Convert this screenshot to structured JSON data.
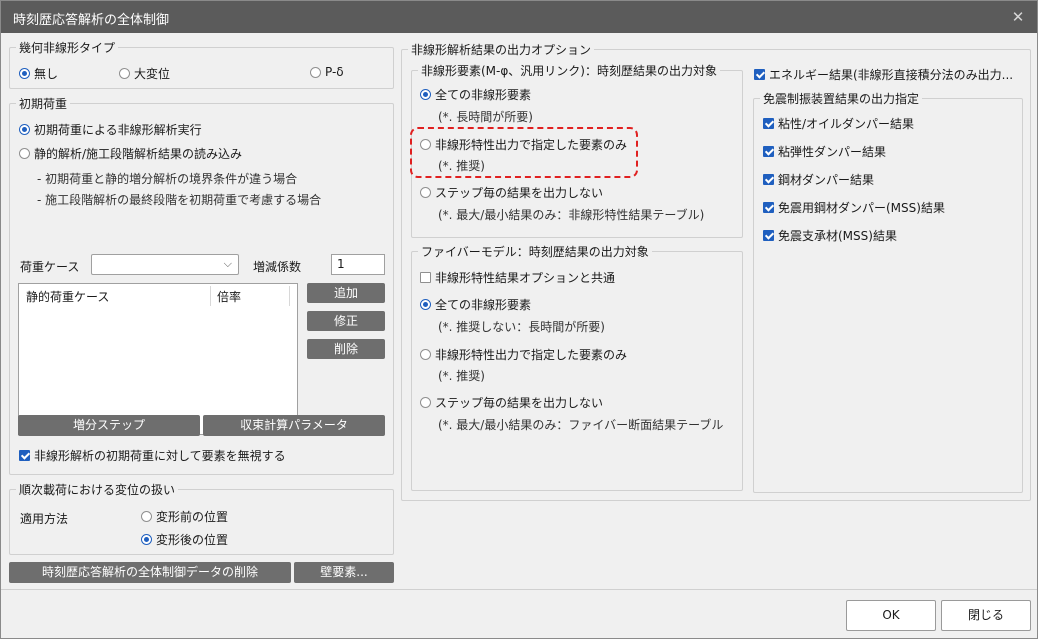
{
  "window": {
    "title": "時刻歴応答解析の全体制御"
  },
  "icons": {
    "close": "✕",
    "dropdown": "⌵"
  },
  "nonlinear_type": {
    "legend": "幾何非線形タイプ",
    "options": [
      "無し",
      "大変位",
      "P-δ"
    ],
    "selected": "無し"
  },
  "initial_load": {
    "legend": "初期荷重",
    "option_run": "初期荷重による非線形解析実行",
    "option_read": "静的解析/施工段階解析結果の読み込み",
    "note1": "- 初期荷重と静的増分解析の境界条件が違う場合",
    "note2": "- 施工段階解析の最終段階を初期荷重で考慮する場合",
    "load_case_label": "荷重ケース",
    "load_case_value": "",
    "factor_label": "増減係数",
    "factor_value": "1",
    "table_headers": [
      "静的荷重ケース",
      "倍率"
    ],
    "add_button": "追加",
    "modify_button": "修正",
    "delete_button": "削除",
    "incremental_step_button": "増分ステップ",
    "convergence_button": "収束計算パラメータ",
    "ignore_elements_label": "非線形解析の初期荷重に対して要素を無視する"
  },
  "sequential_load": {
    "legend": "順次載荷における変位の扱い",
    "method_label": "適用方法",
    "option_before": "変形前の位置",
    "option_after": "変形後の位置",
    "selected": "変形後の位置"
  },
  "bottom_buttons": {
    "delete_data": "時刻歴応答解析の全体制御データの削除",
    "wall_elements": "壁要素..."
  },
  "output_options": {
    "legend": "非線形解析結果の出力オプション",
    "nonlinear_elements": {
      "legend": "非線形要素(M-φ、汎用リンク)：時刻歴結果の出力対象",
      "opt_all": "全ての非線形要素",
      "opt_all_note": "(*. 長時間が所要)",
      "opt_specified": "非線形特性出力で指定した要素のみ",
      "opt_specified_note": "(*. 推奨)",
      "opt_none": "ステップ毎の結果を出力しない",
      "opt_none_note": "(*. 最大/最小結果のみ：非線形特性結果テーブル)",
      "selected": "全ての非線形要素"
    },
    "fiber_model": {
      "legend": "ファイバーモデル：時刻歴結果の出力対象",
      "common_label": "非線形特性結果オプションと共通",
      "opt_all": "全ての非線形要素",
      "opt_all_note": "(*. 推奨しない：長時間が所要)",
      "opt_specified": "非線形特性出力で指定した要素のみ",
      "opt_specified_note": "(*. 推奨)",
      "opt_none": "ステップ毎の結果を出力しない",
      "opt_none_note": "(*. 最大/最小結果のみ：ファイバー断面結果テーブル",
      "selected": "全ての非線形要素"
    },
    "energy_label": "エネルギー結果(非線形直接積分法のみ出力...",
    "damper_output": {
      "legend": "免震制振装置結果の出力指定",
      "items": [
        "粘性/オイルダンパー結果",
        "粘弾性ダンパー結果",
        "鋼材ダンパー結果",
        "免震用鋼材ダンパー(MSS)結果",
        "免震支承材(MSS)結果"
      ]
    }
  },
  "dialog_buttons": {
    "ok": "OK",
    "close": "閉じる"
  },
  "colors": {
    "titlebar": "#5b5b5b",
    "accent": "#1f5fbf",
    "highlight": "#e02020",
    "dark_button": "#6e6e6e"
  }
}
